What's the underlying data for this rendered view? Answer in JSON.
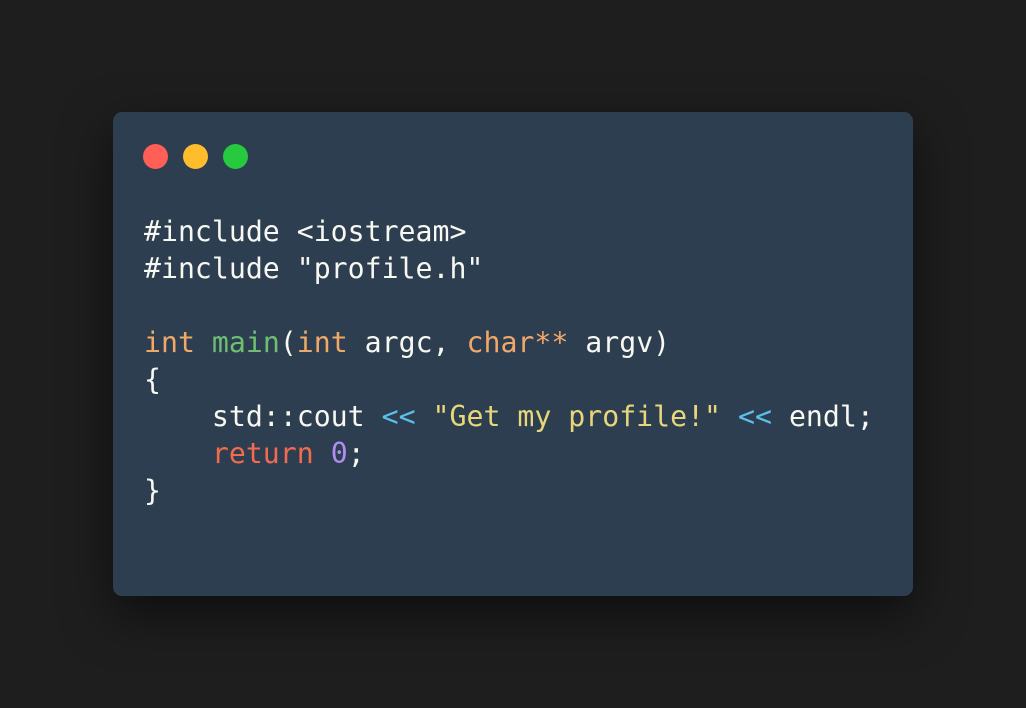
{
  "window": {
    "controls": [
      {
        "name": "close",
        "color": "#ff5f56"
      },
      {
        "name": "minimize",
        "color": "#ffbd2e"
      },
      {
        "name": "zoom",
        "color": "#27c93f"
      }
    ]
  },
  "colors": {
    "background": "#1e1e1e",
    "window": "#2d3e50",
    "default_text": "#f8f8f2",
    "type_keyword": "#f0a868",
    "function_name": "#6fbf73",
    "operator": "#5bc0eb",
    "string": "#e8d77a",
    "return_keyword": "#f26b4f",
    "number": "#b38cf0"
  },
  "code": {
    "lines": [
      [
        {
          "t": "#include <iostream>",
          "c": "default_text"
        }
      ],
      [
        {
          "t": "#include \"profile.h\"",
          "c": "default_text"
        }
      ],
      [],
      [
        {
          "t": "int",
          "c": "type_keyword"
        },
        {
          "t": " ",
          "c": "default_text"
        },
        {
          "t": "main",
          "c": "function_name"
        },
        {
          "t": "(",
          "c": "default_text"
        },
        {
          "t": "int",
          "c": "type_keyword"
        },
        {
          "t": " argc, ",
          "c": "default_text"
        },
        {
          "t": "char**",
          "c": "type_keyword"
        },
        {
          "t": " argv)",
          "c": "default_text"
        }
      ],
      [
        {
          "t": "{",
          "c": "default_text"
        }
      ],
      [
        {
          "t": "    std::cout ",
          "c": "default_text"
        },
        {
          "t": "<<",
          "c": "operator"
        },
        {
          "t": " ",
          "c": "default_text"
        },
        {
          "t": "\"Get my profile!\"",
          "c": "string"
        },
        {
          "t": " ",
          "c": "default_text"
        },
        {
          "t": "<<",
          "c": "operator"
        },
        {
          "t": " endl;",
          "c": "default_text"
        }
      ],
      [
        {
          "t": "    ",
          "c": "default_text"
        },
        {
          "t": "return",
          "c": "return_keyword"
        },
        {
          "t": " ",
          "c": "default_text"
        },
        {
          "t": "0",
          "c": "number"
        },
        {
          "t": ";",
          "c": "default_text"
        }
      ],
      [
        {
          "t": "}",
          "c": "default_text"
        }
      ]
    ]
  }
}
